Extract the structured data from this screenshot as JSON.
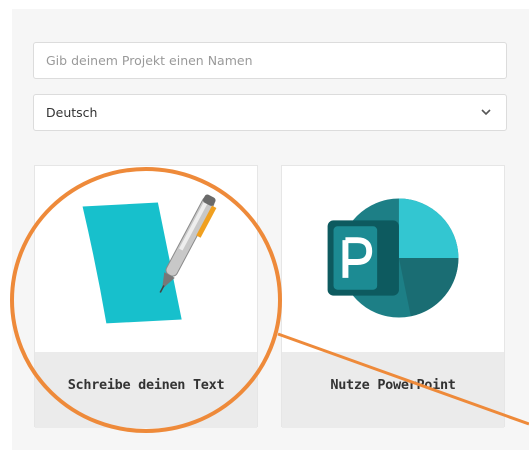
{
  "form": {
    "project_name_placeholder": "Gib deinem Projekt einen Namen",
    "project_name_value": "",
    "language_selected": "Deutsch"
  },
  "cards": [
    {
      "label": "Schreibe deinen Text",
      "icon": "write-text-icon"
    },
    {
      "label": "Nutze PowerPoint",
      "icon": "powerpoint-icon"
    }
  ],
  "colors": {
    "annotation": "#ee8a3a",
    "paper": "#17c0cc",
    "powerpoint_dark": "#1d7f86",
    "powerpoint_light": "#33c6d1"
  }
}
